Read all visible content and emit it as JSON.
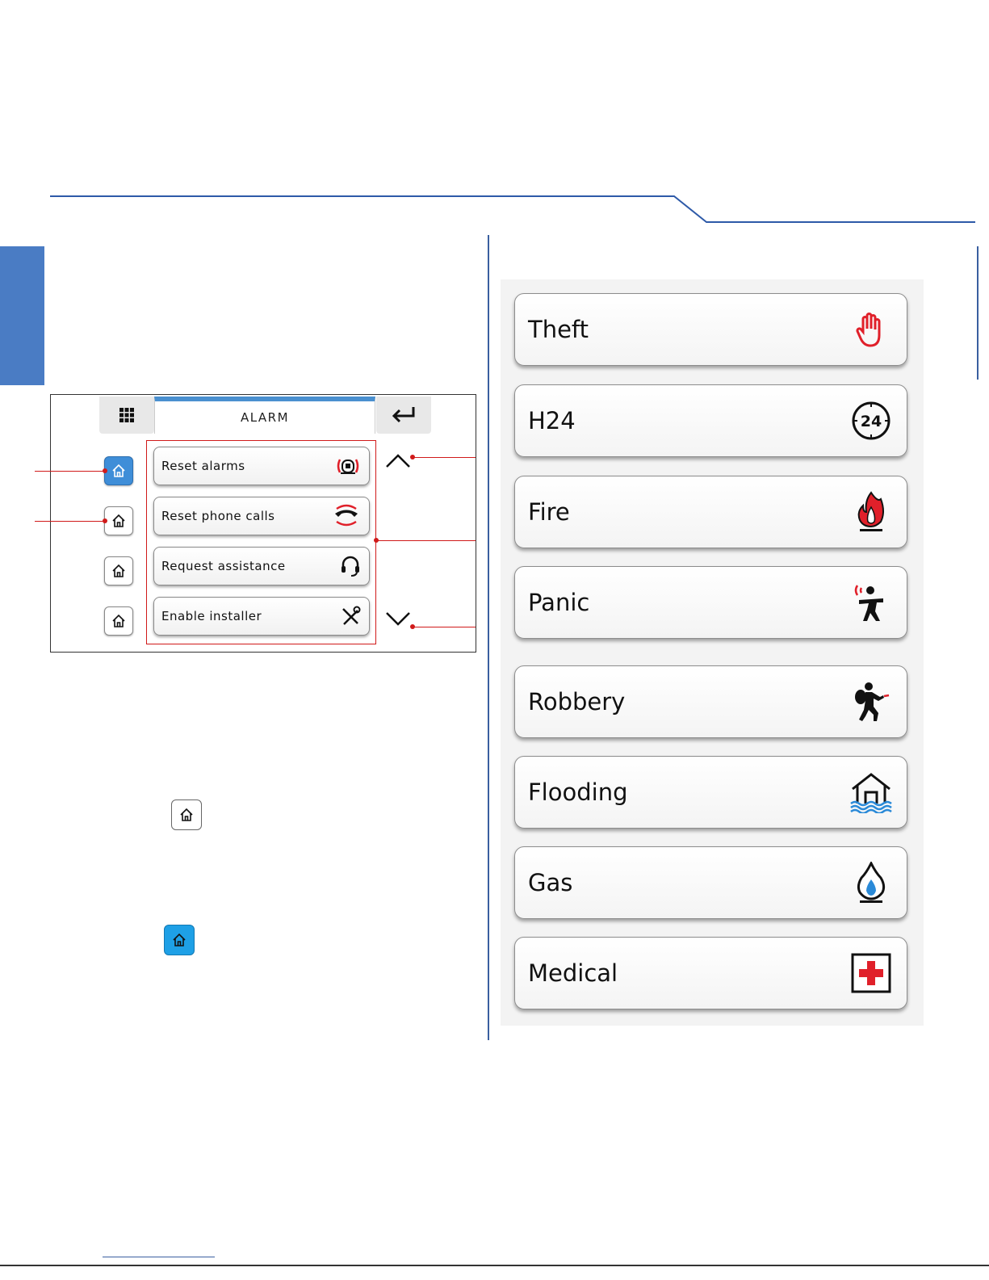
{
  "screen": {
    "title": "ALARM",
    "actions": [
      {
        "label": "Reset alarms",
        "icon": "siren-reset-icon"
      },
      {
        "label": "Reset phone calls",
        "icon": "phone-reset-icon"
      },
      {
        "label": "Request assistance",
        "icon": "headset-icon"
      },
      {
        "label": "Enable installer",
        "icon": "tools-icon"
      }
    ],
    "zones": [
      "home-icon",
      "home-icon",
      "home-icon",
      "home-icon"
    ]
  },
  "scenarios": [
    {
      "label": "Theft",
      "icon": "hand-stop-icon"
    },
    {
      "label": "H24",
      "icon": "clock-24-icon"
    },
    {
      "label": "Fire",
      "icon": "fire-icon"
    },
    {
      "label": "Panic",
      "icon": "panic-person-icon"
    },
    {
      "label": "Robbery",
      "icon": "robber-icon"
    },
    {
      "label": "Flooding",
      "icon": "flooding-house-icon"
    },
    {
      "label": "Gas",
      "icon": "gas-flame-icon"
    },
    {
      "label": "Medical",
      "icon": "medical-cross-icon"
    }
  ],
  "colors": {
    "accent_blue": "#4a7cc4",
    "active_home": "#3f8ed8",
    "callout_red": "#d01a1a",
    "icon_red": "#e0202a",
    "gas_blue": "#2a8ad8"
  }
}
